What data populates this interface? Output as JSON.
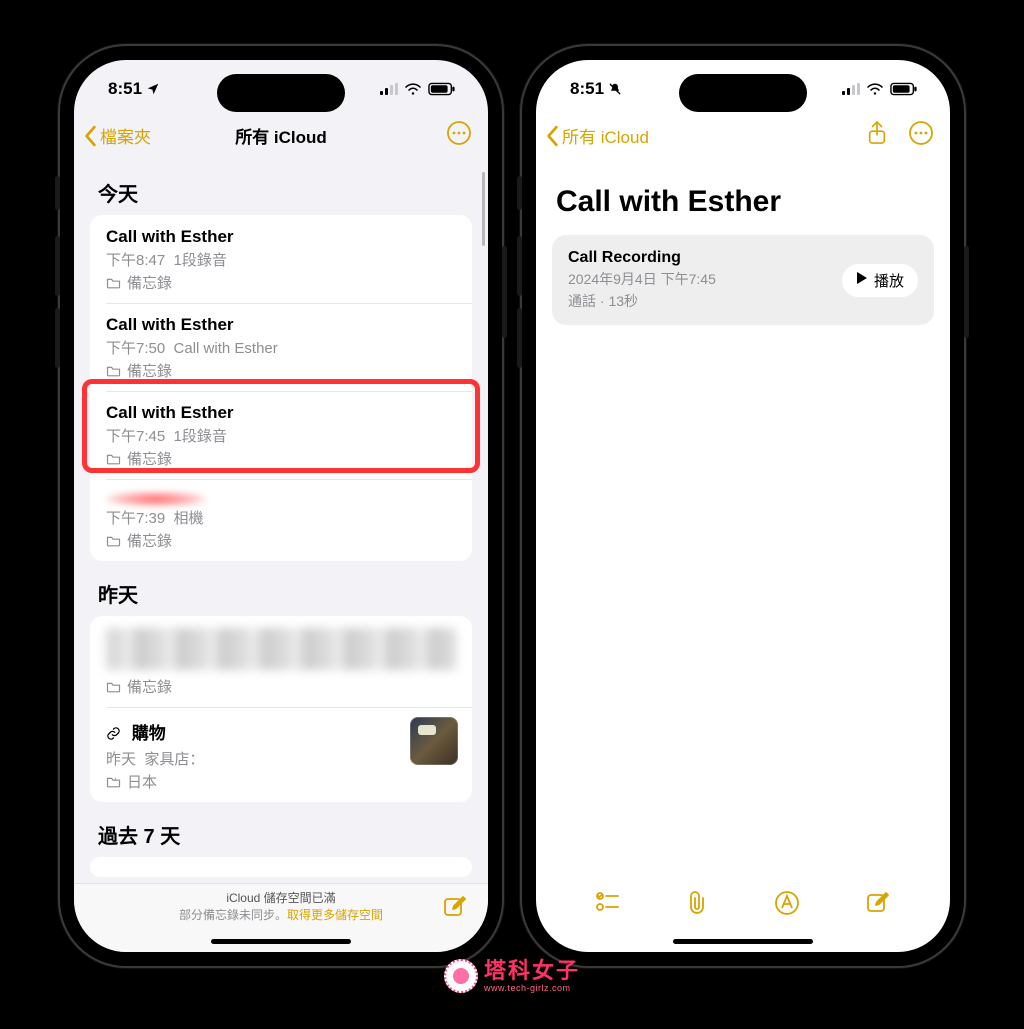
{
  "status": {
    "time": "8:51",
    "location_glyph": "location-arrow",
    "mute_glyph": "bell-slash"
  },
  "accent": "#d7a400",
  "left_phone": {
    "nav": {
      "back_label": "檔案夾",
      "title": "所有 iCloud"
    },
    "sections": [
      {
        "header": "今天",
        "items": [
          {
            "title": "Call with Esther",
            "time": "下午8:47",
            "preview": "1段錄音",
            "folder": "備忘錄",
            "highlighted": false
          },
          {
            "title": "Call with Esther",
            "time": "下午7:50",
            "preview": "Call with Esther",
            "folder": "備忘錄",
            "highlighted": false
          },
          {
            "title": "Call with Esther",
            "time": "下午7:45",
            "preview": "1段錄音",
            "folder": "備忘錄",
            "highlighted": true
          },
          {
            "title": "",
            "time": "下午7:39",
            "preview": "相機",
            "folder": "備忘錄",
            "highlighted": false,
            "redacted_title": true
          }
        ]
      },
      {
        "header": "昨天",
        "items": [
          {
            "title": "",
            "time": "",
            "preview": "",
            "folder": "備忘錄",
            "blurred": true
          },
          {
            "title": "購物",
            "time": "昨天",
            "preview": "家具店：",
            "folder": "日本",
            "has_link_icon": true,
            "has_thumb": true,
            "pinned_folder": true
          }
        ]
      },
      {
        "header": "過去 7 天",
        "items": []
      }
    ],
    "bottom": {
      "line1": "iCloud 儲存空間已滿",
      "line2_a": "部分備忘錄未同步。",
      "line2_link": "取得更多儲存空間"
    }
  },
  "right_phone": {
    "nav": {
      "back_label": "所有 iCloud"
    },
    "title": "Call with Esther",
    "recording": {
      "heading": "Call Recording",
      "timestamp": "2024年9月4日 下午7:45",
      "meta": "通話 · 13秒",
      "play_label": "播放"
    }
  },
  "watermark": {
    "cn": "塔科女子",
    "en": "www.tech-girlz.com"
  }
}
